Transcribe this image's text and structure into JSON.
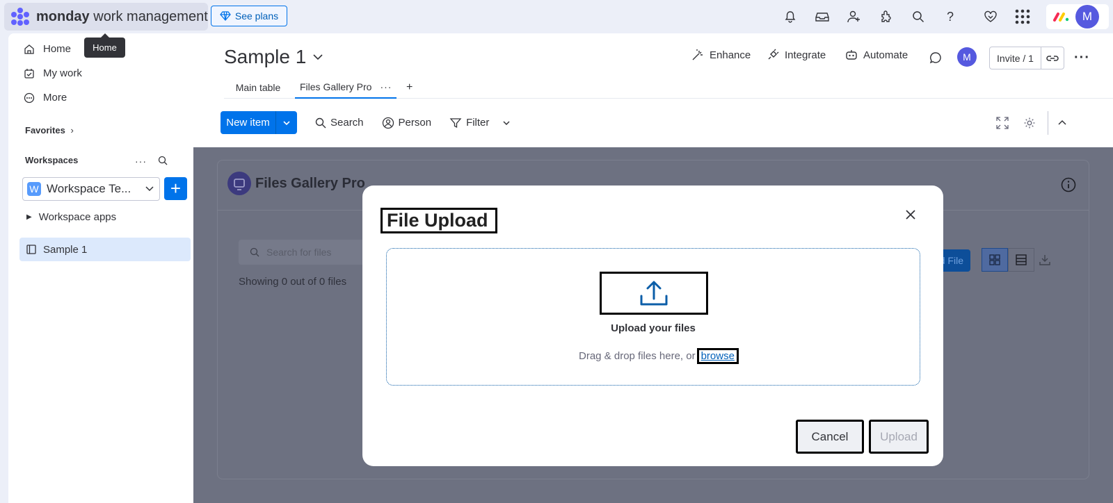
{
  "topbar": {
    "brand_bold": "monday",
    "brand_rest": " work management",
    "see_plans": "See plans",
    "avatar_letter": "M",
    "icons": [
      "bell-icon",
      "inbox-icon",
      "invite-members-icon",
      "integrations-icon",
      "search-icon",
      "help-icon",
      "heart-icon",
      "apps-grid-icon"
    ]
  },
  "tooltip": "Home",
  "sidebar": {
    "nav": [
      "Home",
      "My work",
      "More"
    ],
    "favorites": "Favorites",
    "workspaces": "Workspaces",
    "workspace_name": "Workspace Te...",
    "workspace_initial": "W",
    "workspace_apps": "Workspace apps",
    "board_item": "Sample 1"
  },
  "board": {
    "title": "Sample 1",
    "actions": [
      "Enhance",
      "Integrate",
      "Automate"
    ],
    "avatar_letter": "M",
    "invite": "Invite / 1",
    "tabs": [
      "Main table",
      "Files Gallery Pro"
    ],
    "add_tab": "+"
  },
  "toolbar": {
    "new_item": "New item",
    "search": "Search",
    "person": "Person",
    "filter": "Filter"
  },
  "view": {
    "title": "Files Gallery Pro",
    "search_placeholder": "Search for files",
    "showing": "Showing 0 out of 0 files",
    "upload_file_partial": "oad File"
  },
  "modal": {
    "title": "File Upload",
    "dropzone_title": "Upload your files",
    "hint": "Drag & drop files here, or",
    "browse": "browse",
    "cancel": "Cancel",
    "upload": "Upload"
  },
  "colors": {
    "primary": "#0073ea",
    "avatar": "#5559df",
    "overlay": "#6d7181"
  }
}
